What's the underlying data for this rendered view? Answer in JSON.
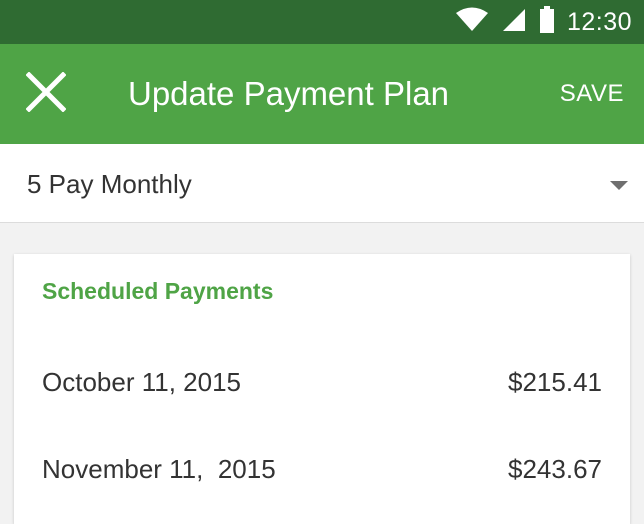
{
  "status_bar": {
    "time": "12:30",
    "icons": [
      "wifi-icon",
      "cell-signal-icon",
      "battery-icon"
    ]
  },
  "app_bar": {
    "close_icon": "close-icon",
    "title": "Update Payment Plan",
    "save_label": "SAVE",
    "color": "#4fa446"
  },
  "plan_select": {
    "selected": "5 Pay Monthly",
    "icon": "dropdown-arrow-icon"
  },
  "scheduled": {
    "title": "Scheduled Payments",
    "payments": [
      {
        "date": "October 11, 2015",
        "amount": "$215.41"
      },
      {
        "date": "November 11,  2015",
        "amount": "$243.67"
      }
    ]
  },
  "colors": {
    "status_bar": "#2f6b32",
    "accent": "#4fa446",
    "text": "#333333"
  }
}
